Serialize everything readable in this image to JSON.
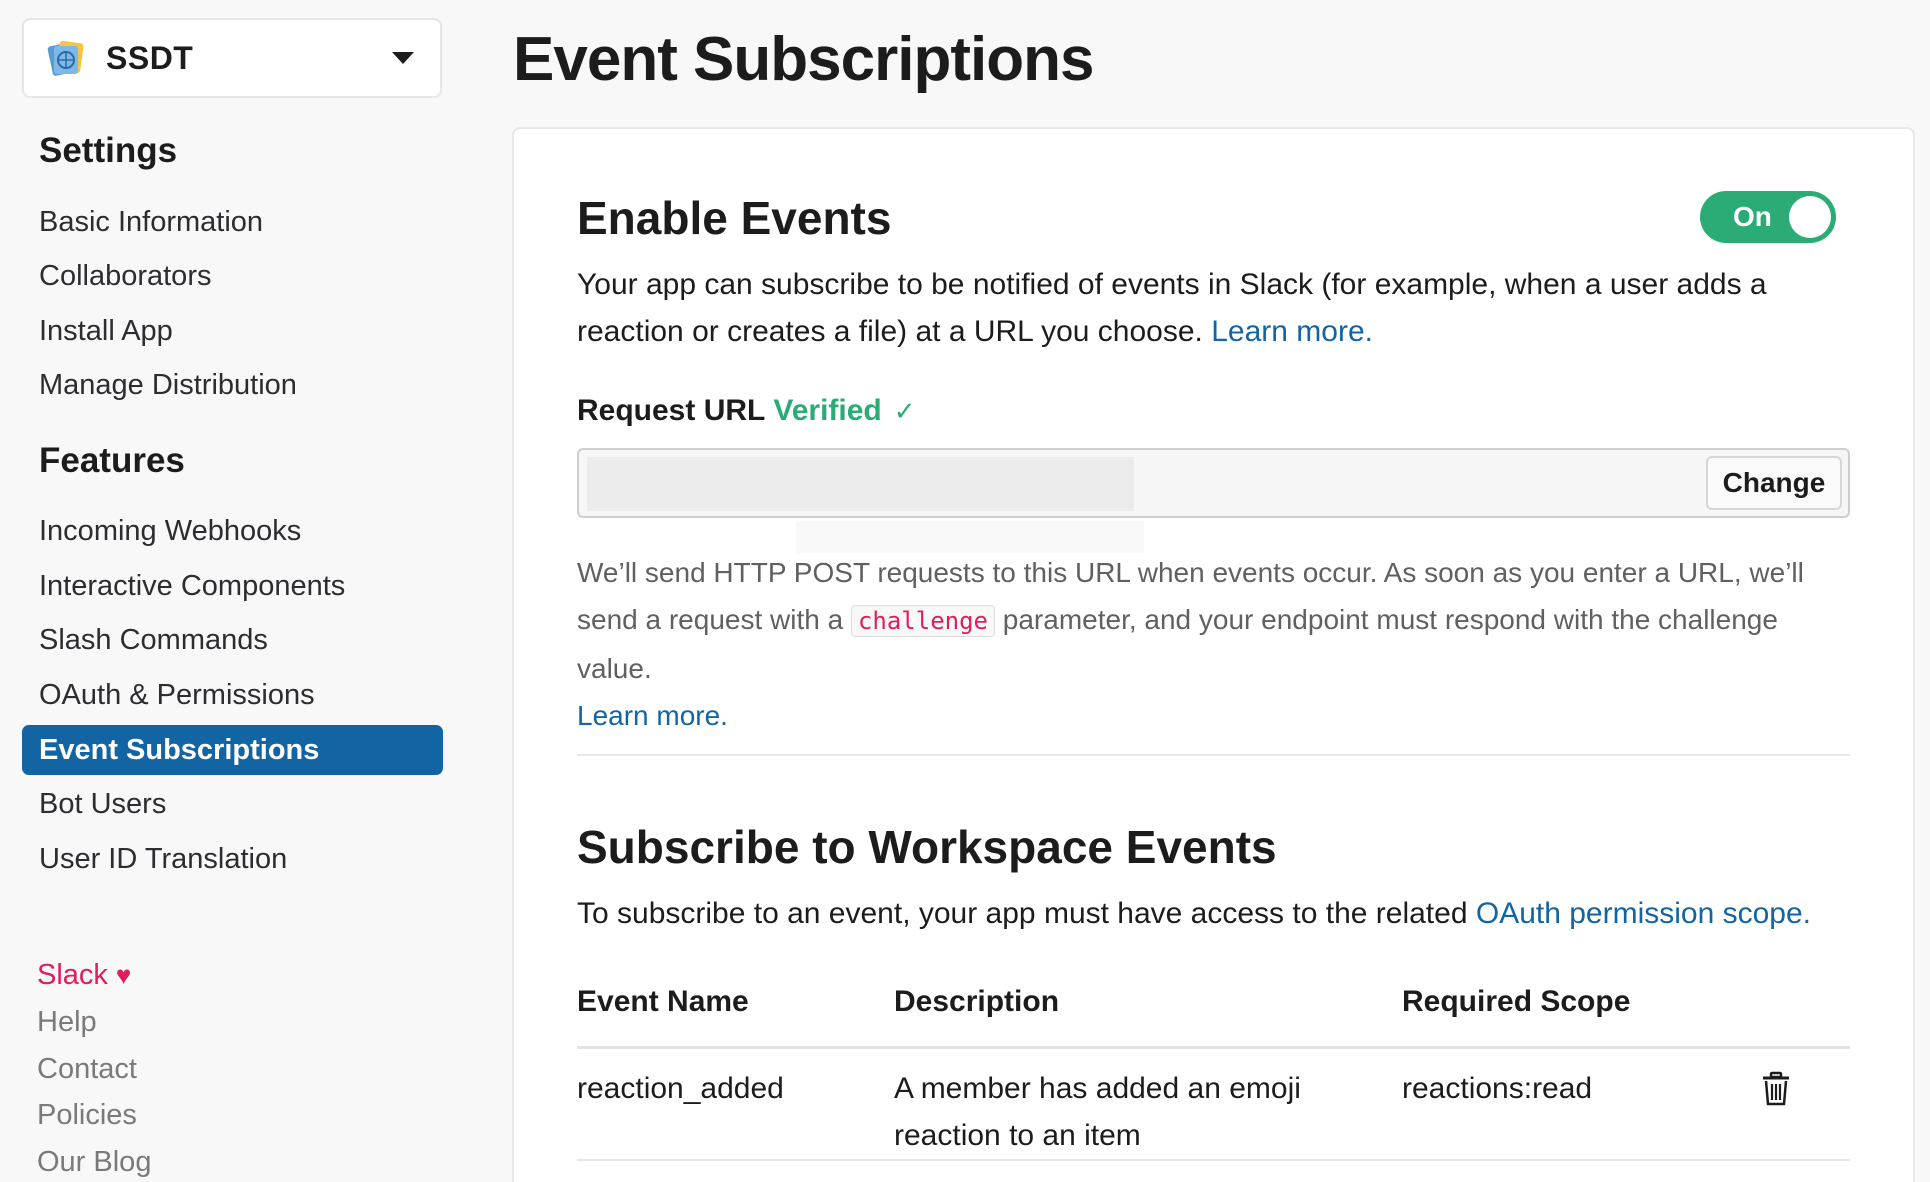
{
  "sidebar": {
    "app_name": "SSDT",
    "settings_heading": "Settings",
    "settings_items": [
      {
        "label": "Basic Information"
      },
      {
        "label": "Collaborators"
      },
      {
        "label": "Install App"
      },
      {
        "label": "Manage Distribution"
      }
    ],
    "features_heading": "Features",
    "features_items": [
      {
        "label": "Incoming Webhooks"
      },
      {
        "label": "Interactive Components"
      },
      {
        "label": "Slash Commands"
      },
      {
        "label": "OAuth & Permissions"
      },
      {
        "label": "Event Subscriptions",
        "active": true
      },
      {
        "label": "Bot Users"
      },
      {
        "label": "User ID Translation"
      }
    ],
    "footer": {
      "brand": "Slack",
      "heart_icon": "♥",
      "links": [
        "Help",
        "Contact",
        "Policies",
        "Our Blog"
      ]
    }
  },
  "main": {
    "page_title": "Event Subscriptions",
    "enable_events": {
      "title": "Enable Events",
      "toggle_label": "On",
      "toggle_state": "on",
      "description": "Your app can subscribe to be notified of events in Slack (for example, when a user adds a reaction or creates a file) at a URL you choose.",
      "learn_more": "Learn more."
    },
    "request_url": {
      "label": "Request URL",
      "status": "Verified",
      "check_icon": "✓",
      "value": "",
      "change_button": "Change",
      "help_before": "We’ll send HTTP POST requests to this URL when events occur. As soon as you enter a URL, we’ll send a request with a",
      "help_code": "challenge",
      "help_after": "parameter, and your endpoint must respond with the challenge value.",
      "learn_more": "Learn more."
    },
    "workspace_events": {
      "title": "Subscribe to Workspace Events",
      "description": "To subscribe to an event, your app must have access to the related",
      "scope_link": "OAuth permission scope.",
      "columns": [
        "Event Name",
        "Description",
        "Required Scope"
      ],
      "rows": [
        {
          "event": "reaction_added",
          "description": "A member has added an emoji reaction to an item",
          "scope": "reactions:read"
        }
      ]
    }
  },
  "colors": {
    "accent": "#1264a3",
    "success": "#2bac76",
    "brand_red": "#e01e5a"
  }
}
